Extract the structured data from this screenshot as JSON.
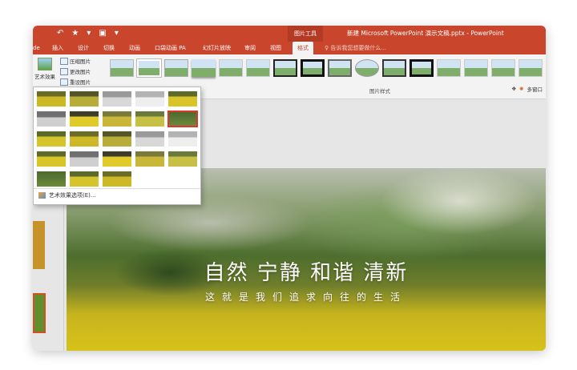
{
  "window": {
    "title": "新建 Microsoft PowerPoint 演示文稿.pptx - PowerPoint",
    "context_tab_group": "图片工具",
    "quick_access": [
      "↶",
      "★",
      "▾",
      "▣",
      "▾"
    ]
  },
  "ribbon_tabs": [
    {
      "label": "de"
    },
    {
      "label": "插入"
    },
    {
      "label": "设计"
    },
    {
      "label": "切换"
    },
    {
      "label": "动画"
    },
    {
      "label": "口袋动画 PA"
    },
    {
      "label": "幻灯片放映"
    },
    {
      "label": "审阅"
    },
    {
      "label": "视图"
    },
    {
      "label": "格式",
      "active": true
    }
  ],
  "tell_me": "♀ 告诉我您想要做什么...",
  "ribbon": {
    "artistic_effects_label": "艺术效果",
    "compress_label": "压缩图片",
    "change_picture_label": "更改图片",
    "reset_picture_label": "重设图片",
    "picture_styles_group": "图片样式",
    "selection_pane_label": "多窗口"
  },
  "dropdown": {
    "options_label": "艺术效果选项(E)...",
    "selected_index": 9,
    "effects_count": 23
  },
  "slide": {
    "headline": "自然  宁静  和谐  清新",
    "subtitle": "这就是我们追求向往的生活"
  },
  "colors": {
    "accent": "#c9452c",
    "selection": "#e0352b",
    "ribbon_bg": "#f3f3f3"
  }
}
